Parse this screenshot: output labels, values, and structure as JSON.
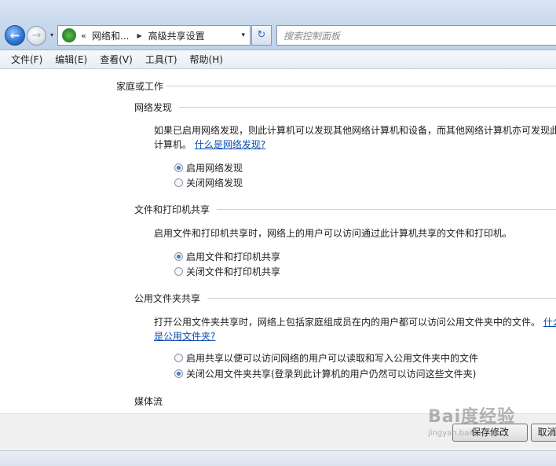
{
  "nav": {
    "back_glyph": "←",
    "fwd_glyph": "→",
    "drop_glyph": "▾",
    "address_chevron": "«",
    "address_crumb": "网络和...",
    "address_sep": "▶",
    "address_current": "高级共享设置",
    "address_drop": "▾",
    "refresh_glyph": "↻",
    "search_placeholder": "搜索控制面板"
  },
  "menu": [
    {
      "label": "文件(F)"
    },
    {
      "label": "编辑(E)"
    },
    {
      "label": "查看(V)"
    },
    {
      "label": "工具(T)"
    },
    {
      "label": "帮助(H)"
    }
  ],
  "profile": {
    "title": "家庭或工作"
  },
  "sections": {
    "discovery": {
      "title": "网络发现",
      "desc_line1": "如果已启用网络发现，则此计算机可以发现其他网络计算机和设备，而其他网络计算机亦可发现此",
      "desc_line2": "计算机。",
      "link": "什么是网络发现?",
      "options": [
        "启用网络发现",
        "关闭网络发现"
      ],
      "selected": 0
    },
    "file_sharing": {
      "title": "文件和打印机共享",
      "desc": "启用文件和打印机共享时，网络上的用户可以访问通过此计算机共享的文件和打印机。",
      "options": [
        "启用文件和打印机共享",
        "关闭文件和打印机共享"
      ],
      "selected": 0
    },
    "public_folder": {
      "title": "公用文件夹共享",
      "desc_line1": "打开公用文件夹共享时，网络上包括家庭组成员在内的用户都可以访问公用文件夹中的文件。",
      "link_part1": "什么",
      "link_part2": "是公用文件夹?",
      "options": [
        "启用共享以便可以访问网络的用户可以读取和写入公用文件夹中的文件",
        "关闭公用文件夹共享(登录到此计算机的用户仍然可以访问这些文件夹)"
      ],
      "selected": 1
    },
    "media": {
      "title": "媒体流"
    }
  },
  "footer": {
    "save_label": "保存修改",
    "cancel_label": "取消"
  },
  "watermark": {
    "main": "Bai度经验",
    "sub": "jingyan.baidu.com"
  },
  "colors": {
    "link": "#0f4dae",
    "accent": "#2f77d6"
  }
}
